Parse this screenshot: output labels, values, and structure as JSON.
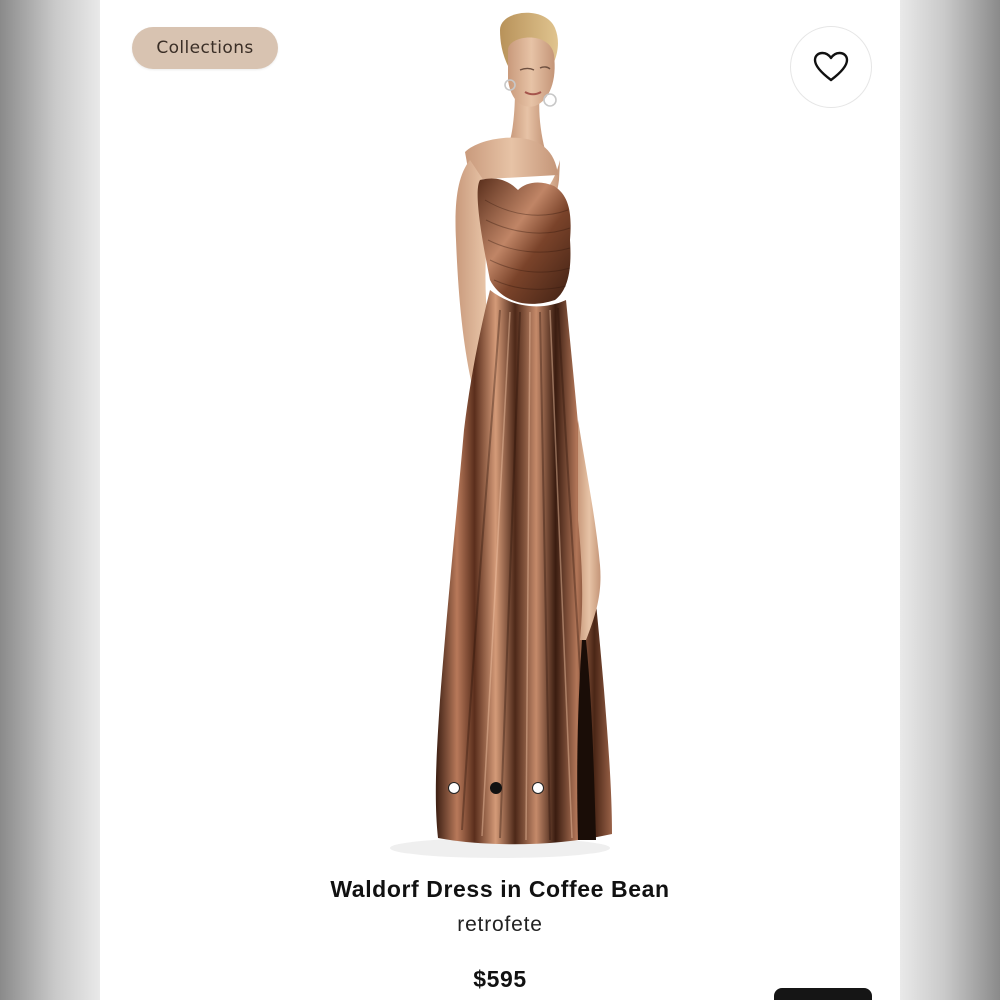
{
  "header": {
    "collections_label": "Collections",
    "favorite_icon": "heart-icon"
  },
  "gallery": {
    "image_alt": "Waldorf Dress in Coffee Bean",
    "slide_count": 3,
    "active_slide": 2
  },
  "product": {
    "title": "Waldorf Dress in Coffee Bean",
    "brand": "retrofete",
    "price": "$595"
  },
  "colors": {
    "chip_bg": "#d8c3b1",
    "dress_bronze": "#8a5538",
    "text": "#111111"
  }
}
